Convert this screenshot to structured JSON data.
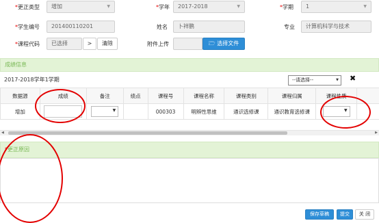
{
  "form": {
    "correction_type": {
      "label": "更正类型",
      "value": "增加"
    },
    "school_year": {
      "label": "学年",
      "value": "2017-2018"
    },
    "semester": {
      "label": "学期",
      "value": "1"
    },
    "student_id": {
      "label": "学生编号",
      "value": "201400110201"
    },
    "name": {
      "label": "姓名",
      "value": "卜祥鹏"
    },
    "major": {
      "label": "专业",
      "value": "计算机科学与技术"
    },
    "course_code": {
      "label": "课程代码",
      "value": "已选择",
      "select_btn": ">",
      "clear_btn": "清除"
    },
    "attachment": {
      "label": "附件上传",
      "button": "选择文件"
    }
  },
  "score_section": {
    "title": "成绩信息",
    "term_text": "2017-2018学年1学期",
    "select_placeholder": "--请选择--",
    "columns": [
      "数据源",
      "成绩",
      "备注",
      "绩点",
      "课程号",
      "课程名称",
      "课程类别",
      "课程归属",
      "课程性质"
    ],
    "row": {
      "source": "增加",
      "score": "",
      "remark": "",
      "gpa": "",
      "course_no": "000303",
      "course_name": "明辨性思维",
      "category": "通识选修课",
      "belong": "通识教育选修课",
      "nature": ""
    }
  },
  "reason_section": {
    "title": "更正原因",
    "value": ""
  },
  "footer": {
    "save_draft": "保存草稿",
    "submit": "提交",
    "close": "关 闭"
  },
  "colors": {
    "required": "#e60000",
    "band_green": "#e3f3d6",
    "band_text": "#7ab856",
    "primary_blue": "#2e8ed7",
    "annotation_red": "#e30000"
  }
}
